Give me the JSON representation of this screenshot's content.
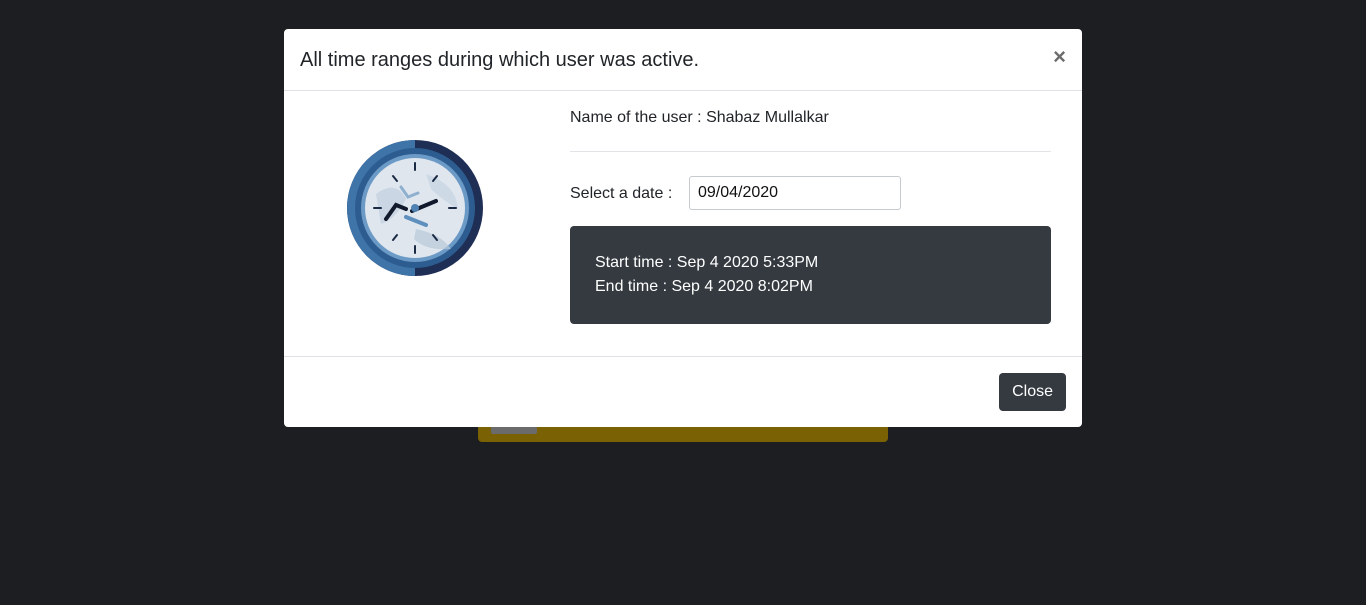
{
  "modal": {
    "title": "All time ranges during which user was active.",
    "close_symbol": "×",
    "user_line": "Name of the user : Shabaz Mullalkar",
    "date_label": "Select a date :",
    "date_value": "09/04/2020",
    "time_ranges": [
      {
        "start": "Start time : Sep 4 2020 5:33PM",
        "end": "End time : Sep 4 2020 8:02PM"
      }
    ],
    "close_button_label": "Close",
    "icon": "clock-icon"
  },
  "colors": {
    "backdrop": "#1c1e21",
    "dark_box": "#343a40",
    "background_card": "#7a6204"
  }
}
